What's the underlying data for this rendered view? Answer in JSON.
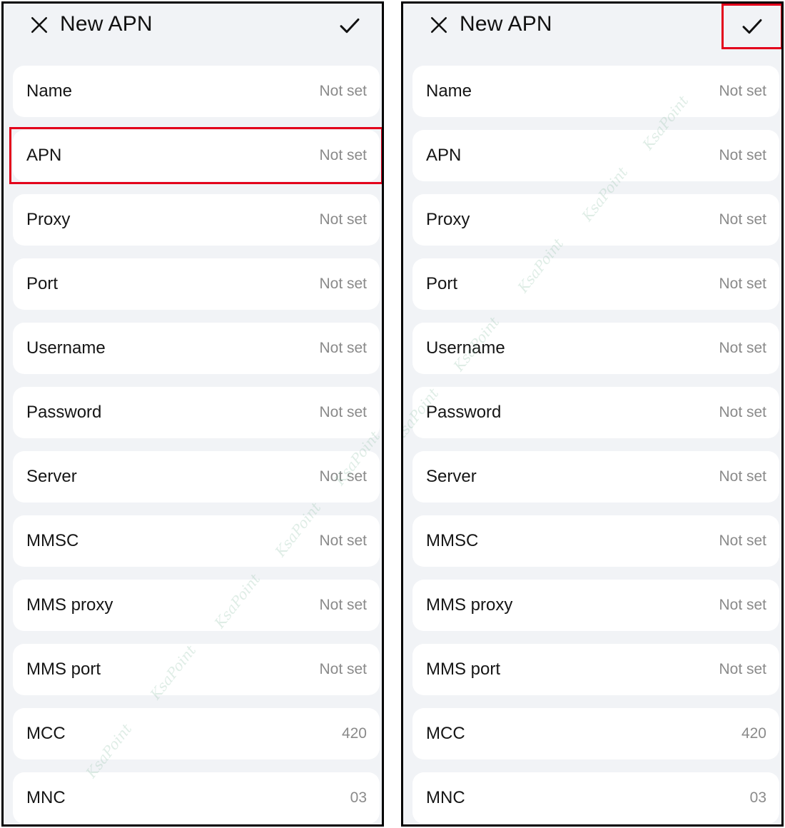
{
  "screens": [
    {
      "title": "New APN",
      "highlight": "apn",
      "fields": [
        {
          "id": "name",
          "label": "Name",
          "value": "Not set"
        },
        {
          "id": "apn",
          "label": "APN",
          "value": "Not set"
        },
        {
          "id": "proxy",
          "label": "Proxy",
          "value": "Not set"
        },
        {
          "id": "port",
          "label": "Port",
          "value": "Not set"
        },
        {
          "id": "username",
          "label": "Username",
          "value": "Not set"
        },
        {
          "id": "password",
          "label": "Password",
          "value": "Not set"
        },
        {
          "id": "server",
          "label": "Server",
          "value": "Not set"
        },
        {
          "id": "mmsc",
          "label": "MMSC",
          "value": "Not set"
        },
        {
          "id": "mms-proxy",
          "label": "MMS proxy",
          "value": "Not set"
        },
        {
          "id": "mms-port",
          "label": "MMS port",
          "value": "Not set"
        },
        {
          "id": "mcc",
          "label": "MCC",
          "value": "420"
        },
        {
          "id": "mnc",
          "label": "MNC",
          "value": "03"
        }
      ]
    },
    {
      "title": "New APN",
      "highlight": "confirm",
      "fields": [
        {
          "id": "name",
          "label": "Name",
          "value": "Not set"
        },
        {
          "id": "apn",
          "label": "APN",
          "value": "Not set"
        },
        {
          "id": "proxy",
          "label": "Proxy",
          "value": "Not set"
        },
        {
          "id": "port",
          "label": "Port",
          "value": "Not set"
        },
        {
          "id": "username",
          "label": "Username",
          "value": "Not set"
        },
        {
          "id": "password",
          "label": "Password",
          "value": "Not set"
        },
        {
          "id": "server",
          "label": "Server",
          "value": "Not set"
        },
        {
          "id": "mmsc",
          "label": "MMSC",
          "value": "Not set"
        },
        {
          "id": "mms-proxy",
          "label": "MMS proxy",
          "value": "Not set"
        },
        {
          "id": "mms-port",
          "label": "MMS port",
          "value": "Not set"
        },
        {
          "id": "mcc",
          "label": "MCC",
          "value": "420"
        },
        {
          "id": "mnc",
          "label": "MNC",
          "value": "03"
        }
      ]
    }
  ],
  "watermark_text": "KsaPoint",
  "colors": {
    "highlight": "#e3001b",
    "background": "#f1f3f6",
    "row": "#ffffff",
    "value_text": "#8a8a8a"
  },
  "icons": {
    "close": "close-icon",
    "confirm": "check-icon"
  }
}
